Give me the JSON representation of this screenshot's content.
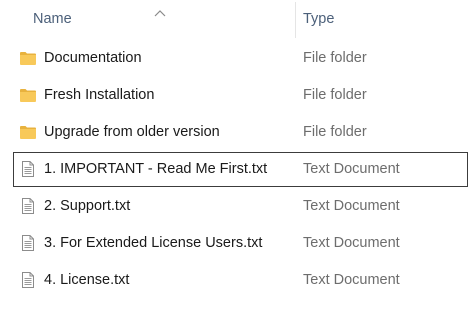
{
  "header": {
    "name_label": "Name",
    "type_label": "Type",
    "sort_direction": "ascending"
  },
  "rows": [
    {
      "name": "Documentation",
      "type": "File folder",
      "icon": "folder-icon",
      "focused": false
    },
    {
      "name": "Fresh Installation",
      "type": "File folder",
      "icon": "folder-icon",
      "focused": false
    },
    {
      "name": "Upgrade from older version",
      "type": "File folder",
      "icon": "folder-icon",
      "focused": false
    },
    {
      "name": "1. IMPORTANT - Read Me First.txt",
      "type": "Text Document",
      "icon": "text-document-icon",
      "focused": true
    },
    {
      "name": "2. Support.txt",
      "type": "Text Document",
      "icon": "text-document-icon",
      "focused": false
    },
    {
      "name": "3. For Extended License Users.txt",
      "type": "Text Document",
      "icon": "text-document-icon",
      "focused": false
    },
    {
      "name": "4. License.txt",
      "type": "Text Document",
      "icon": "text-document-icon",
      "focused": false
    }
  ],
  "colors": {
    "header_text": "#4c607a",
    "name_text": "#1a1a1a",
    "type_text": "#6d6d6d",
    "folder_fill": "#f8c95a",
    "folder_tab": "#e8b23e"
  }
}
